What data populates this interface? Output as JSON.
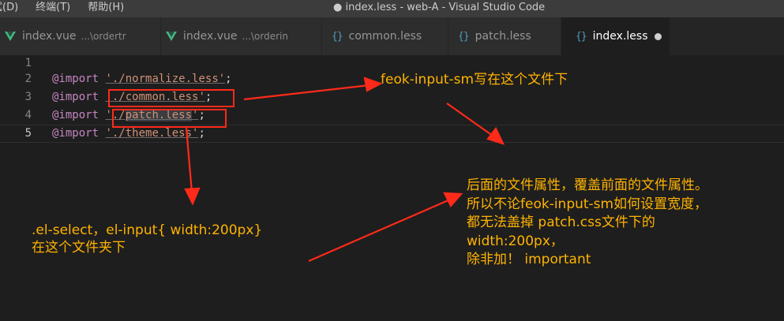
{
  "titlebar": {
    "menus": [
      "试(D)",
      "终端(T)",
      "帮助(H)"
    ],
    "title": "● index.less - web-A - Visual Studio Code"
  },
  "tabs": [
    {
      "label": "index.vue",
      "path": "...\\ordertr",
      "icon": "vue-icon",
      "active": false
    },
    {
      "label": "index.vue",
      "path": "...\\orderin",
      "icon": "vue-icon",
      "active": false
    },
    {
      "label": "common.less",
      "path": "",
      "icon": "braces-icon",
      "active": false
    },
    {
      "label": "patch.less",
      "path": "",
      "icon": "braces-icon",
      "active": false
    },
    {
      "label": "index.less",
      "path": "",
      "icon": "braces-icon",
      "active": true,
      "modified": true
    }
  ],
  "editor": {
    "lines": [
      {
        "number": "1",
        "keyword": "",
        "pre": "",
        "highlight": "",
        "post": "",
        "end": ""
      },
      {
        "number": "2",
        "keyword": "@import",
        "pre": "'./normalize.less'",
        "highlight": "",
        "post": "",
        "end": ";"
      },
      {
        "number": "3",
        "keyword": "@import",
        "pre": "'./common.less'",
        "highlight": "",
        "post": "",
        "end": ";"
      },
      {
        "number": "4",
        "keyword": "@import",
        "pre": "'./",
        "highlight": "patch.less",
        "post": "'",
        "end": ";"
      },
      {
        "number": "5",
        "keyword": "@import",
        "pre": "'./theme.less'",
        "highlight": "",
        "post": "",
        "end": ";"
      }
    ]
  },
  "annotations": {
    "note1": "feok-input-sm写在这个文件下",
    "note2": [
      ".el-select，el-input{ width:200px}",
      "在这个文件夹下"
    ],
    "note3": [
      "后面的文件属性，覆盖前面的文件属性。",
      "所以不论feok-input-sm如何设置宽度，",
      "都无法盖掉 patch.css文件下的",
      "width:200px，",
      "除非加！ important"
    ],
    "color": "#ffb300",
    "arrow_color": "#ff2a1a"
  }
}
